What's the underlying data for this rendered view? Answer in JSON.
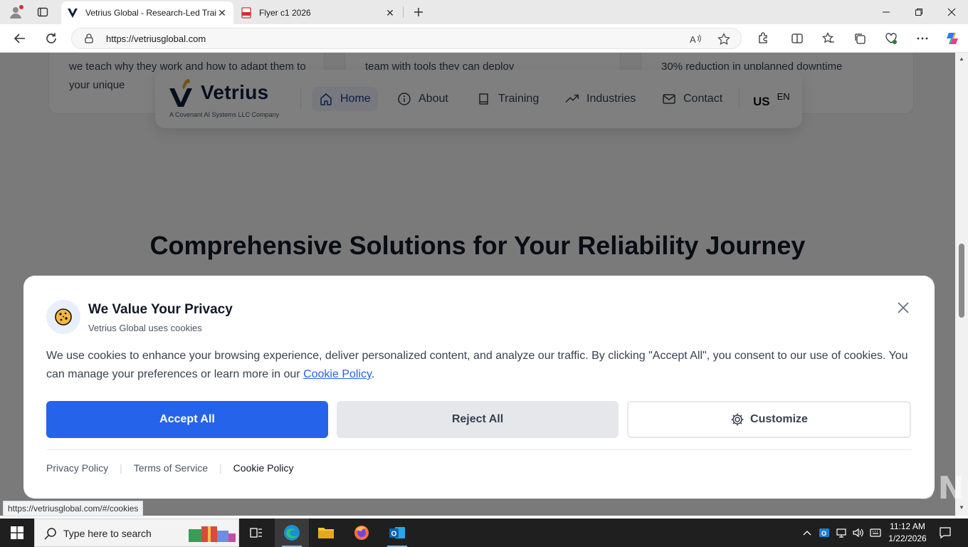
{
  "browser": {
    "tabs": [
      {
        "title": "Vetrius Global - Research-Led Training",
        "active": true
      },
      {
        "title": "Flyer c1 2026",
        "active": false
      }
    ],
    "url": "https://vetriusglobal.com",
    "status_url": "https://vetriusglobal.com/#/cookies"
  },
  "page": {
    "cards": [
      {
        "text": "we teach why they work and how to adapt them to your unique"
      },
      {
        "text": "team with tools they can deploy"
      },
      {
        "text": "30% reduction in unplanned downtime"
      }
    ],
    "nav": {
      "logo_text": "Vetrius",
      "logo_sub": "A Covenant AI Systems LLC Company",
      "items": [
        {
          "label": "Home",
          "icon": "home-icon"
        },
        {
          "label": "About",
          "icon": "info-icon"
        },
        {
          "label": "Training",
          "icon": "book-icon"
        },
        {
          "label": "Industries",
          "icon": "trending-up-icon"
        },
        {
          "label": "Contact",
          "icon": "mail-icon"
        }
      ],
      "lang_flag": "US",
      "lang_code": "EN"
    },
    "section_title": "Comprehensive Solutions for Your Reliability Journey"
  },
  "cookie": {
    "title": "We Value Your Privacy",
    "subtitle": "Vetrius Global uses cookies",
    "body_text": "We use cookies to enhance your browsing experience, deliver personalized content, and analyze our traffic. By clicking \"Accept All\", you consent to our use of cookies. You can manage your preferences or learn more in our ",
    "body_link": "Cookie Policy",
    "body_end": ".",
    "accept_label": "Accept All",
    "reject_label": "Reject All",
    "customize_label": "Customize",
    "footer_links": [
      "Privacy Policy",
      "Terms of Service",
      "Cookie Policy"
    ]
  },
  "watermark": "ANY RUN",
  "taskbar": {
    "search_placeholder": "Type here to search",
    "time": "11:12 AM",
    "date": "1/22/2026"
  },
  "colors": {
    "accent": "#2563eb",
    "brand_navy": "#0f1f3d",
    "brand_gold": "#e0a526"
  }
}
